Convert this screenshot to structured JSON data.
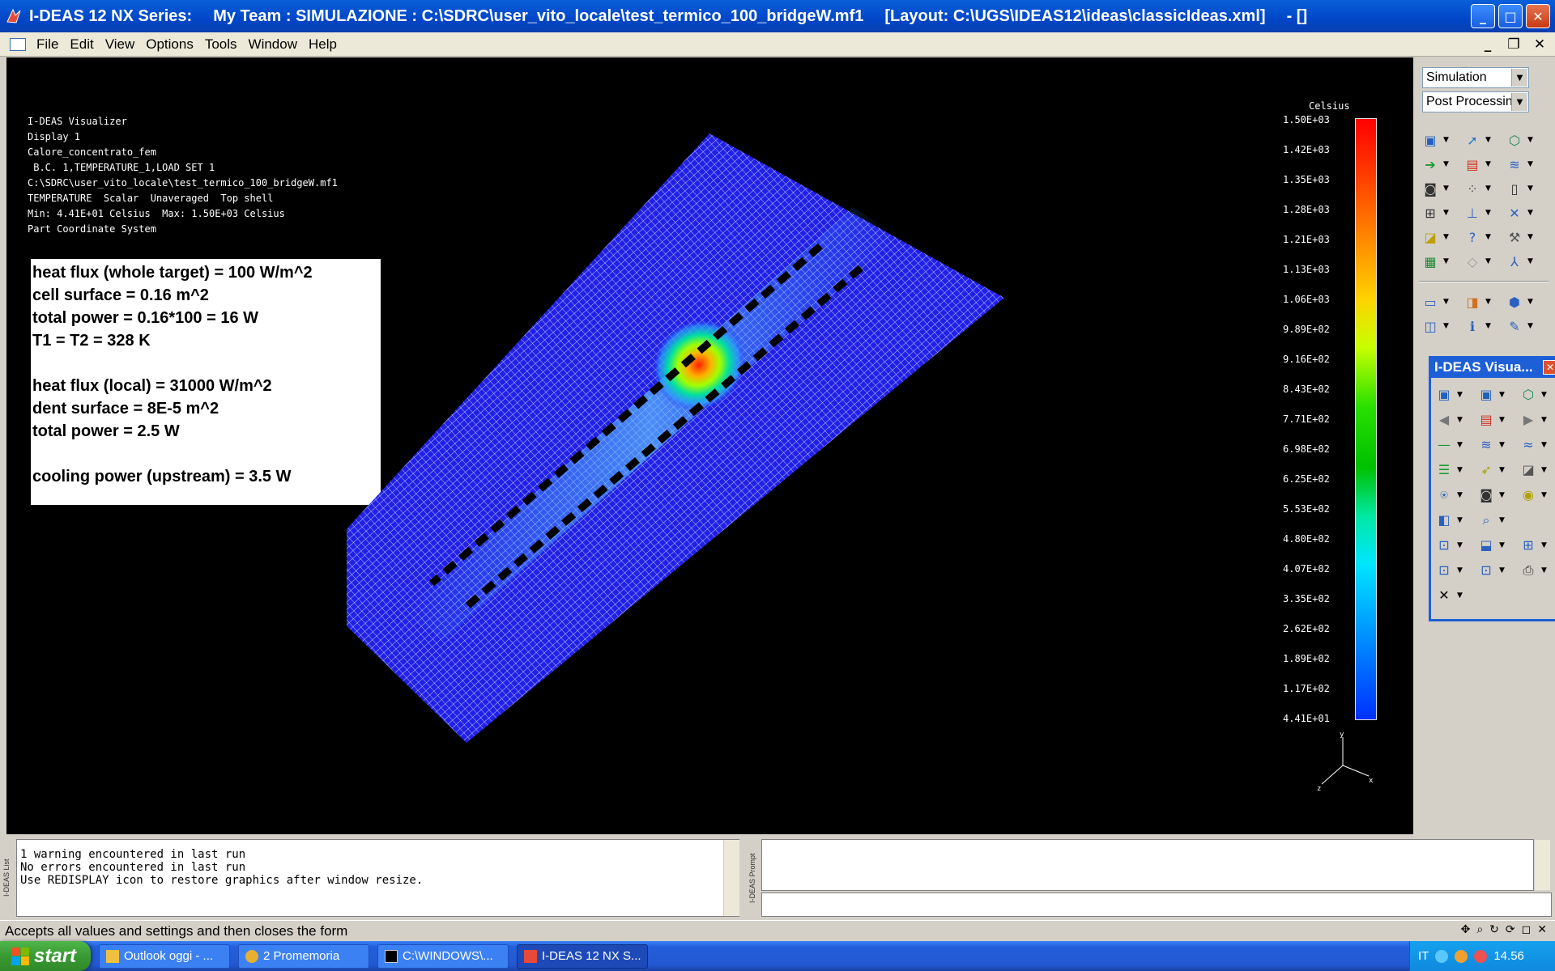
{
  "window": {
    "app_name": "I-DEAS 12 NX Series:",
    "team": "My Team : SIMULAZIONE : C:\\SDRC\\user_vito_locale\\test_termico_100_bridgeW.mf1",
    "layout": "[Layout: C:\\UGS\\IDEAS12\\ideas\\classicIdeas.xml]",
    "suffix": "- []"
  },
  "menu": [
    "File",
    "Edit",
    "View",
    "Options",
    "Tools",
    "Window",
    "Help"
  ],
  "visualizer_info": [
    "I-DEAS Visualizer",
    "Display 1",
    "Calore_concentrato_fem",
    " B.C. 1,TEMPERATURE_1,LOAD SET 1",
    "C:\\SDRC\\user_vito_locale\\test_termico_100_bridgeW.mf1",
    "TEMPERATURE  Scalar  Unaveraged  Top shell",
    "Min: 4.41E+01 Celsius  Max: 1.50E+03 Celsius",
    "Part Coordinate System"
  ],
  "note_lines": [
    "heat flux (whole target) = 100 W/m^2",
    "cell surface = 0.16 m^2",
    "total power = 0.16*100 = 16 W",
    "T1 = T2 = 328 K",
    "",
    "heat flux (local) = 31000 W/m^2",
    "dent surface = 8E-5 m^2",
    "total power = 2.5 W",
    "",
    "cooling power (upstream) = 3.5 W"
  ],
  "legend": {
    "unit": "Celsius",
    "ticks": [
      "1.50E+03",
      "1.42E+03",
      "1.35E+03",
      "1.28E+03",
      "1.21E+03",
      "1.13E+03",
      "1.06E+03",
      "9.89E+02",
      "9.16E+02",
      "8.43E+02",
      "7.71E+02",
      "6.98E+02",
      "6.25E+02",
      "5.53E+02",
      "4.80E+02",
      "4.07E+02",
      "3.35E+02",
      "2.62E+02",
      "1.89E+02",
      "1.17E+02",
      "4.41E+01"
    ]
  },
  "triad": {
    "x": "x",
    "y": "y",
    "z": "z"
  },
  "panel": {
    "task": "Simulation",
    "subtask": "Post Processing"
  },
  "float_window": {
    "title": "I-DEAS Visua..."
  },
  "list_panel": {
    "label": "I-DEAS List",
    "lines": [
      "1 warning encountered in last run",
      "No errors encountered in last run",
      "Use REDISPLAY icon to restore graphics after window resize."
    ]
  },
  "prompt_panel": {
    "label": "I-DEAS Prompt"
  },
  "status": "Accepts all values and settings and then closes the form",
  "taskbar": {
    "start": "start",
    "buttons": [
      "Outlook oggi - ...",
      "2 Promemoria",
      "C:\\WINDOWS\\...",
      "I-DEAS 12 NX S..."
    ],
    "lang": "IT",
    "clock": "14.56"
  }
}
